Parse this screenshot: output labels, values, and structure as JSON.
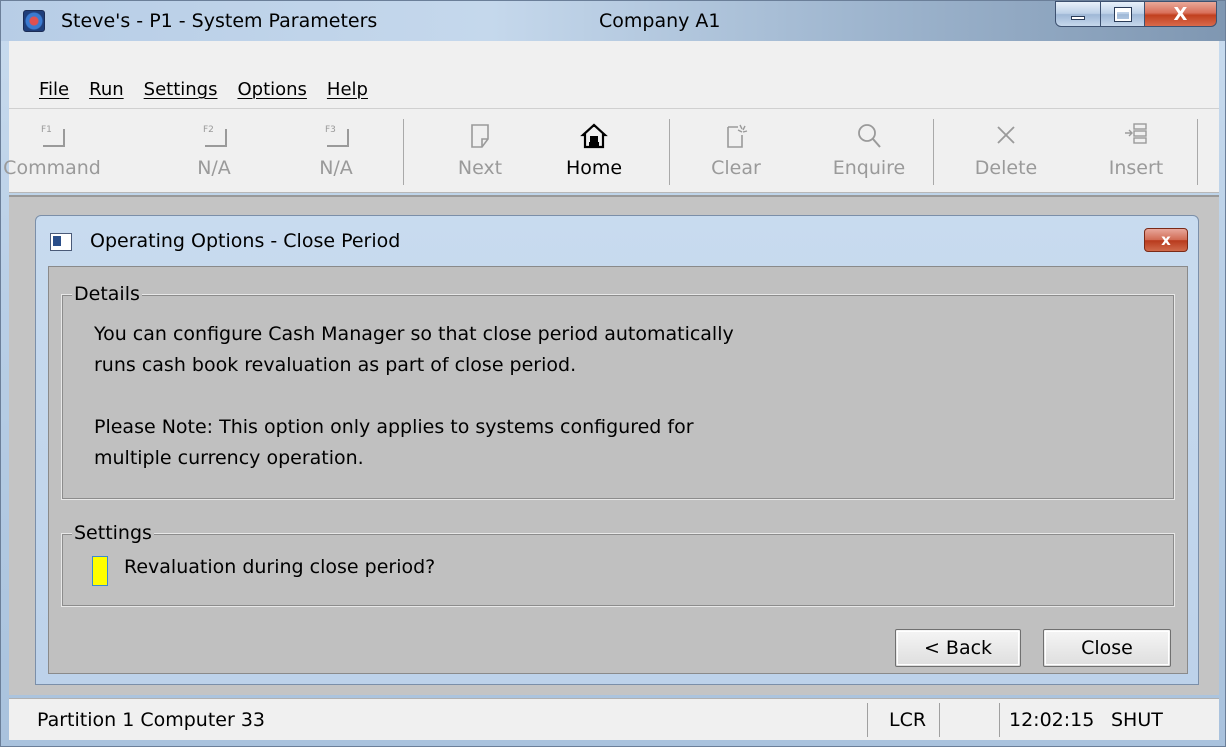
{
  "window": {
    "title": "Steve's - P1 - System Parameters",
    "company": "Company A1",
    "close_glyph": "X"
  },
  "menu": [
    "File",
    "Run",
    "Settings",
    "Options",
    "Help"
  ],
  "toolbar": {
    "command": "Command",
    "f1": "F1",
    "na1": "N/A",
    "f2": "F2",
    "na2": "N/A",
    "f3": "F3",
    "next": "Next",
    "home": "Home",
    "clear": "Clear",
    "enquire": "Enquire",
    "delete": "Delete",
    "insert": "Insert"
  },
  "dialog": {
    "title": "Operating Options - Close Period",
    "close_glyph": "x",
    "details_legend": "Details",
    "details_line1": "You can configure Cash Manager so that close period automatically",
    "details_line2": "runs cash book revaluation as part of close period.",
    "details_line3": "Please Note: This option only applies to systems configured for",
    "details_line4": "multiple currency operation.",
    "settings_legend": "Settings",
    "checkbox_label": "Revaluation during close period?",
    "checkbox_checked": false,
    "back_button": "< Back",
    "close_button": "Close"
  },
  "status": {
    "partition": "Partition 1 Computer 33",
    "lcr": "LCR",
    "time": "12:02:15",
    "shut": "SHUT"
  },
  "colors": {
    "checkbox_fill": "#ffff00",
    "dialog_body": "#c0c0c0"
  }
}
